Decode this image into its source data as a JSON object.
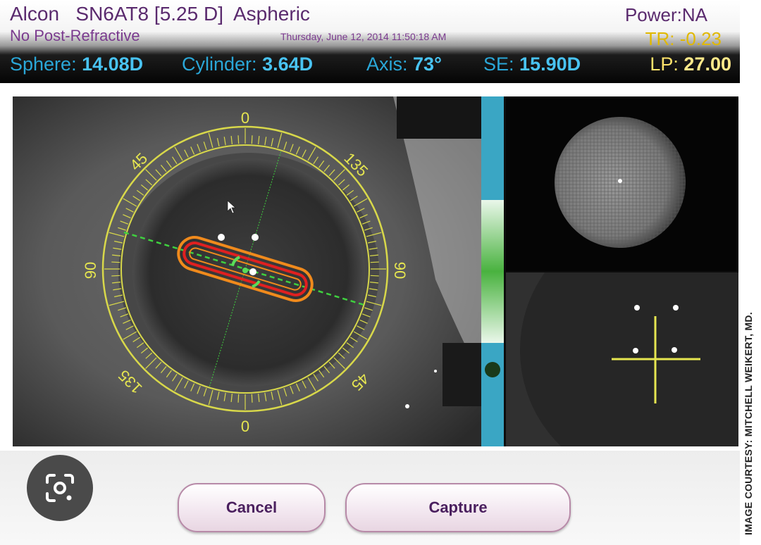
{
  "header": {
    "brand": "Alcon",
    "lens_model": "SN6AT8 [5.25 D]",
    "lens_type": "Aspheric",
    "post_refractive": "No Post-Refractive",
    "datetime": "Thursday, June 12, 2014 11:50:18 AM",
    "power": "Power:NA",
    "tr": "TR: -0.23",
    "sphere_label": "Sphere:",
    "sphere_value": "14.08D",
    "cylinder_label": "Cylinder:",
    "cylinder_value": "3.64D",
    "axis_label": "Axis:",
    "axis_value": "73°",
    "se_label": "SE:",
    "se_value": "15.90D",
    "lp_label": "LP:",
    "lp_value": "27.00"
  },
  "overlay": {
    "dial_labels": [
      "0",
      "45",
      "135",
      "90",
      "90",
      "135",
      "45",
      "0"
    ],
    "axis_degrees": 73,
    "ring_color": "#d8d84a",
    "marker_colors": {
      "outer": "#f08a1c",
      "inner": "#e02020",
      "axis": "#5adc5a"
    }
  },
  "buttons": {
    "cancel": "Cancel",
    "capture": "Capture"
  },
  "icons": {
    "lens_search": "camera-lens-search-icon"
  },
  "credit": "IMAGE COURTESY: MITCHELL WEIKERT, MD."
}
